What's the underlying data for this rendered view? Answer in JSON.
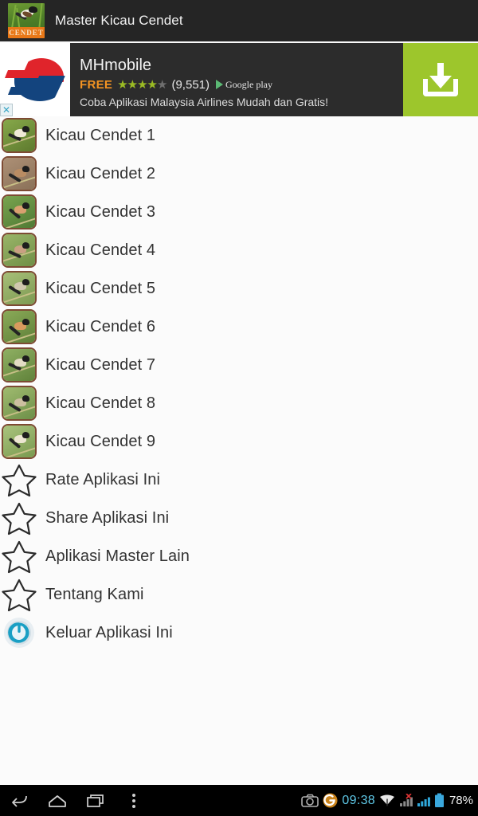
{
  "titlebar": {
    "app_name": "Master Kicau Cendet",
    "icon_name": "app-icon-cendet",
    "icon_band_text": "CENDET"
  },
  "ad": {
    "advertiser": "MHmobile",
    "price_label": "FREE",
    "rating_filled": 4,
    "rating_total": 5,
    "review_count": "(9,551)",
    "store_label": "Google play",
    "tagline": "Coba Aplikasi Malaysia Airlines Mudah dan Gratis!",
    "cta_icon": "download-icon",
    "close_label": "✕",
    "cta_color": "#9dc62c",
    "price_color": "#f39322",
    "star_on_color": "#9bbb24",
    "star_off_color": "#6e6e6e"
  },
  "list": {
    "items": [
      {
        "label": "Kicau Cendet 1",
        "icon": "bird-thumbnail-1",
        "type": "sound"
      },
      {
        "label": "Kicau Cendet 2",
        "icon": "bird-thumbnail-2",
        "type": "sound"
      },
      {
        "label": "Kicau Cendet 3",
        "icon": "bird-thumbnail-3",
        "type": "sound"
      },
      {
        "label": "Kicau Cendet 4",
        "icon": "bird-thumbnail-4",
        "type": "sound"
      },
      {
        "label": "Kicau Cendet 5",
        "icon": "bird-thumbnail-5",
        "type": "sound"
      },
      {
        "label": "Kicau Cendet 6",
        "icon": "bird-thumbnail-6",
        "type": "sound"
      },
      {
        "label": "Kicau Cendet 7",
        "icon": "bird-thumbnail-7",
        "type": "sound"
      },
      {
        "label": "Kicau Cendet 8",
        "icon": "bird-thumbnail-8",
        "type": "sound"
      },
      {
        "label": "Kicau Cendet 9",
        "icon": "bird-thumbnail-9",
        "type": "sound"
      },
      {
        "label": "Rate Aplikasi Ini",
        "icon": "star-icon",
        "type": "star"
      },
      {
        "label": "Share Aplikasi Ini",
        "icon": "star-icon",
        "type": "star"
      },
      {
        "label": "Aplikasi Master Lain",
        "icon": "star-icon",
        "type": "star"
      },
      {
        "label": "Tentang Kami",
        "icon": "star-icon",
        "type": "star"
      },
      {
        "label": "Keluar Aplikasi Ini",
        "icon": "power-icon",
        "type": "power"
      }
    ]
  },
  "navbar": {
    "back_icon": "back-icon",
    "home_icon": "home-icon",
    "recents_icon": "recents-icon",
    "overflow_icon": "overflow-menu-icon",
    "status": {
      "camera_icon": "camera-icon",
      "app_badge_icon": "orange-app-badge-icon",
      "clock": "09:38",
      "wifi_icon": "wifi-icon",
      "signal_off_icon": "signal-no-service-icon",
      "signal_icon": "signal-bars-icon",
      "battery_icon": "battery-icon",
      "battery_percent": "78%",
      "clock_color": "#5fc9e8"
    }
  }
}
